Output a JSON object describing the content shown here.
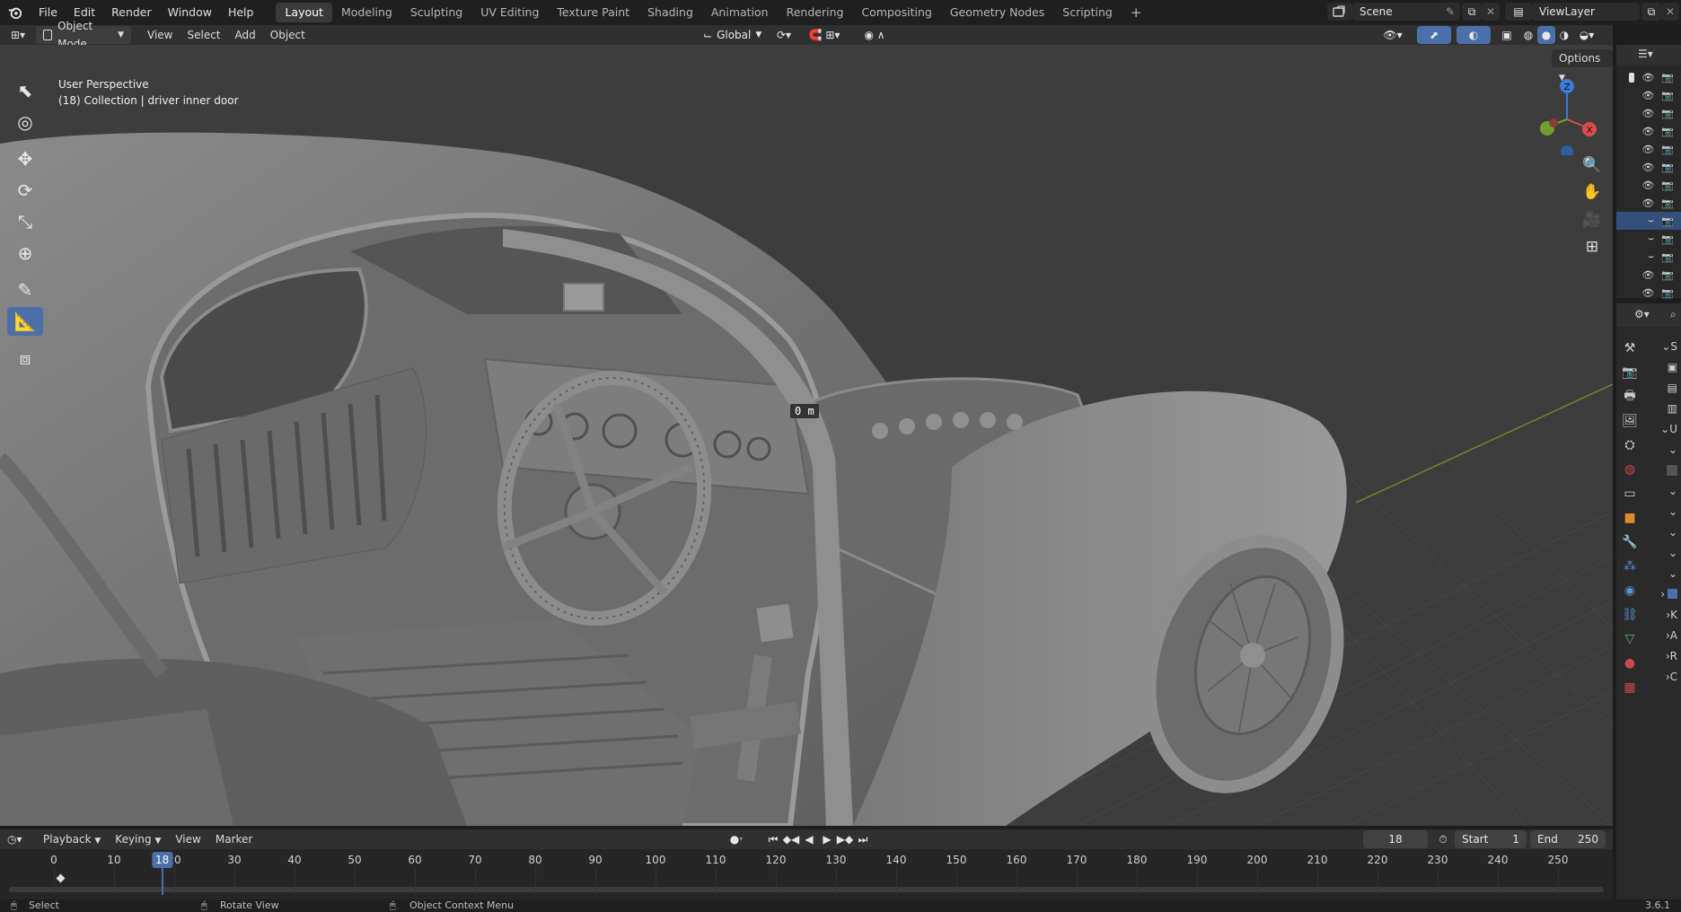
{
  "app": {
    "menu": [
      "File",
      "Edit",
      "Render",
      "Window",
      "Help"
    ],
    "workspaces": [
      "Layout",
      "Modeling",
      "Sculpting",
      "UV Editing",
      "Texture Paint",
      "Shading",
      "Animation",
      "Rendering",
      "Compositing",
      "Geometry Nodes",
      "Scripting"
    ],
    "active_workspace": "Layout",
    "add_workspace": "+",
    "scene_name": "Scene",
    "view_layer_name": "ViewLayer"
  },
  "header": {
    "mode": "Object Mode",
    "menus": [
      "View",
      "Select",
      "Add",
      "Object"
    ],
    "transform_orientation": "Global",
    "options_label": "Options"
  },
  "viewport": {
    "view_name": "User Perspective",
    "collection_info": "(18) Collection | driver inner door",
    "measure_label": "0 m",
    "gizmo": {
      "z_label": "Z",
      "x_label": "X"
    },
    "colors": {
      "background": "#3d3d3d",
      "grid_green": "#6c8a2c",
      "gizmo_x": "#d94c4c",
      "gizmo_y": "#6ea02e",
      "gizmo_z": "#3c7bd6"
    }
  },
  "tools": [
    {
      "name": "select-box-tool",
      "icon": "cursor-arrow-icon"
    },
    {
      "name": "cursor-tool",
      "icon": "crosshair-icon"
    },
    {
      "name": "move-tool",
      "icon": "move-arrows-icon"
    },
    {
      "name": "rotate-tool",
      "icon": "rotate-icon"
    },
    {
      "name": "scale-tool",
      "icon": "scale-icon"
    },
    {
      "name": "transform-tool",
      "icon": "transform-icon"
    },
    {
      "name": "annotate-tool",
      "icon": "pencil-icon"
    },
    {
      "name": "measure-tool",
      "icon": "ruler-icon",
      "active": true
    },
    {
      "name": "add-cube-tool",
      "icon": "cube-add-icon"
    }
  ],
  "outliner": {
    "rows": [
      {
        "visible": true,
        "selected": false
      },
      {
        "visible": true,
        "selected": false
      },
      {
        "visible": true,
        "selected": false
      },
      {
        "visible": true,
        "selected": false
      },
      {
        "visible": true,
        "selected": false
      },
      {
        "visible": true,
        "selected": false
      },
      {
        "visible": true,
        "selected": false
      },
      {
        "visible": true,
        "selected": false
      },
      {
        "visible": false,
        "selected": true
      },
      {
        "visible": false,
        "selected": false
      },
      {
        "visible": false,
        "selected": false
      },
      {
        "visible": true,
        "selected": false
      },
      {
        "visible": true,
        "selected": false
      }
    ]
  },
  "properties": {
    "panel_letters": [
      "S",
      "U",
      "K",
      "A",
      "R",
      "C"
    ]
  },
  "timeline": {
    "menus": [
      "Playback",
      "Keying",
      "View",
      "Marker"
    ],
    "current_frame": "18",
    "start_label": "Start",
    "start_value": "1",
    "end_label": "End",
    "end_value": "250",
    "ticks": [
      "0",
      "10",
      "20",
      "30",
      "40",
      "50",
      "60",
      "70",
      "80",
      "90",
      "100",
      "110",
      "120",
      "130",
      "140",
      "150",
      "160",
      "170",
      "180",
      "190",
      "200",
      "210",
      "220",
      "230",
      "240",
      "250"
    ],
    "playhead_frame": 18,
    "keyframes": [
      1
    ]
  },
  "status": {
    "left_action": "Select",
    "middle_action": "Rotate View",
    "right_action": "Object Context Menu",
    "version": "3.6.1"
  }
}
